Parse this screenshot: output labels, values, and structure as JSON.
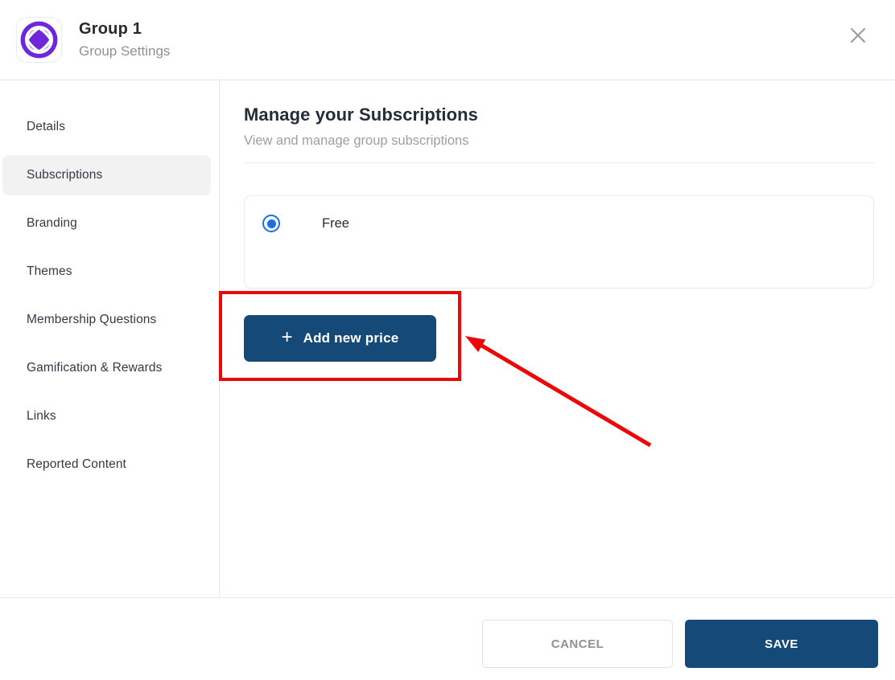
{
  "header": {
    "title": "Group 1",
    "subtitle": "Group Settings",
    "logo_icon": "group-circle-logo",
    "close_icon": "x"
  },
  "sidebar": {
    "items": [
      {
        "label": "Details",
        "active": false
      },
      {
        "label": "Subscriptions",
        "active": true
      },
      {
        "label": "Branding",
        "active": false
      },
      {
        "label": "Themes",
        "active": false
      },
      {
        "label": "Membership Questions",
        "active": false
      },
      {
        "label": "Gamification & Rewards",
        "active": false
      },
      {
        "label": "Links",
        "active": false
      },
      {
        "label": "Reported Content",
        "active": false
      }
    ]
  },
  "main": {
    "heading": "Manage your Subscriptions",
    "subheading": "View and manage group subscriptions",
    "plan": {
      "label": "Free",
      "selected": true
    },
    "add_button": {
      "icon_glyph": "+",
      "label": "Add new price"
    }
  },
  "footer": {
    "cancel_label": "CANCEL",
    "save_label": "SAVE"
  },
  "colors": {
    "primary_navy": "#154a78",
    "brand_purple": "#6e28d9",
    "radio_blue": "#1a6fe8",
    "annotation_red": "#ec0808",
    "selected_item_bg": "#f2f2f3"
  }
}
